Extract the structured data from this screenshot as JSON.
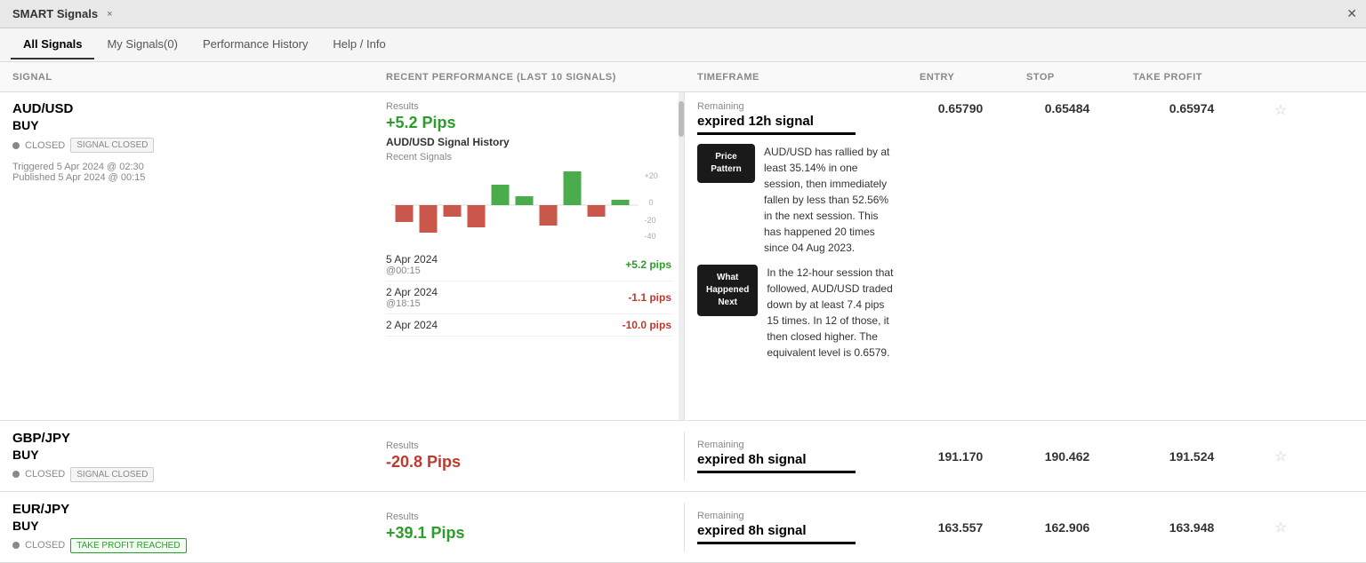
{
  "app": {
    "title": "SMART Signals",
    "close_tab_label": "×",
    "close_app_label": "✕"
  },
  "nav": {
    "tabs": [
      {
        "id": "all-signals",
        "label": "All Signals",
        "active": true
      },
      {
        "id": "my-signals",
        "label": "My Signals(0)",
        "active": false
      },
      {
        "id": "performance-history",
        "label": "Performance History",
        "active": false
      },
      {
        "id": "help-info",
        "label": "Help / Info",
        "active": false
      }
    ]
  },
  "columns": {
    "signal": "SIGNAL",
    "recent_performance": "RECENT PERFORMANCE (LAST 10 SIGNALS)",
    "timeframe": "TIMEFRAME",
    "entry": "ENTRY",
    "stop": "STOP",
    "take_profit": "TAKE PROFIT"
  },
  "signals": [
    {
      "id": "audusd",
      "pair": "AUD/USD",
      "direction": "BUY",
      "status_dot": "closed",
      "status": "CLOSED",
      "badge": "SIGNAL CLOSED",
      "badge_type": "normal",
      "triggered": "Triggered  5 Apr 2024 @ 02:30",
      "published": "Published  5 Apr 2024 @ 00:15",
      "results_label": "Results",
      "results_value": "+5.2 Pips",
      "results_positive": true,
      "history_title": "AUD/USD Signal History",
      "history_subtitle": "Recent Signals",
      "chart_bars": [
        {
          "value": -15,
          "type": "neg"
        },
        {
          "value": -25,
          "type": "neg"
        },
        {
          "value": -10,
          "type": "neg"
        },
        {
          "value": -20,
          "type": "neg"
        },
        {
          "value": 18,
          "type": "pos"
        },
        {
          "value": 8,
          "type": "pos"
        },
        {
          "value": -18,
          "type": "neg"
        },
        {
          "value": 30,
          "type": "pos"
        },
        {
          "value": -10,
          "type": "neg"
        },
        {
          "value": 5,
          "type": "pos"
        }
      ],
      "chart_y_labels": [
        "+20",
        "0",
        "-20",
        "-40"
      ],
      "history_items": [
        {
          "date": "5 Apr 2024",
          "time": "@00:15",
          "pips": "+5.2 pips",
          "positive": true
        },
        {
          "date": "2 Apr 2024",
          "time": "@18:15",
          "pips": "-1.1 pips",
          "positive": false
        },
        {
          "date": "2 Apr 2024",
          "time": "",
          "pips": "-10.0 pips",
          "positive": false
        }
      ],
      "timeframe_label": "Remaining",
      "timeframe_value": "expired 12h signal",
      "entry": "0.65790",
      "stop": "0.65484",
      "take_profit": "0.65974",
      "info_panels": [
        {
          "badge": "Price Pattern",
          "text": "AUD/USD has rallied by at least 35.14% in one session, then immediately fallen by less than 52.56% in the next session. This has happened 20 times since 04 Aug 2023."
        },
        {
          "badge": "What Happened Next",
          "text": "In the 12-hour session that followed, AUD/USD traded down by at least 7.4 pips 15 times. In 12 of those, it then closed higher. The equivalent level is 0.6579."
        }
      ]
    },
    {
      "id": "gbpjpy",
      "pair": "GBP/JPY",
      "direction": "BUY",
      "status": "CLOSED",
      "badge": "SIGNAL CLOSED",
      "badge_type": "normal",
      "results_label": "Results",
      "results_value": "-20.8 Pips",
      "results_positive": false,
      "timeframe_label": "Remaining",
      "timeframe_value": "expired 8h signal",
      "entry": "191.170",
      "stop": "190.462",
      "take_profit": "191.524"
    },
    {
      "id": "eurjpy",
      "pair": "EUR/JPY",
      "direction": "BUY",
      "status": "CLOSED",
      "badge": "TAKE PROFIT REACHED",
      "badge_type": "green",
      "results_label": "Results",
      "results_value": "+39.1 Pips",
      "results_positive": true,
      "timeframe_label": "Remaining",
      "timeframe_value": "expired 8h signal",
      "entry": "163.557",
      "stop": "162.906",
      "take_profit": "163.948"
    }
  ]
}
